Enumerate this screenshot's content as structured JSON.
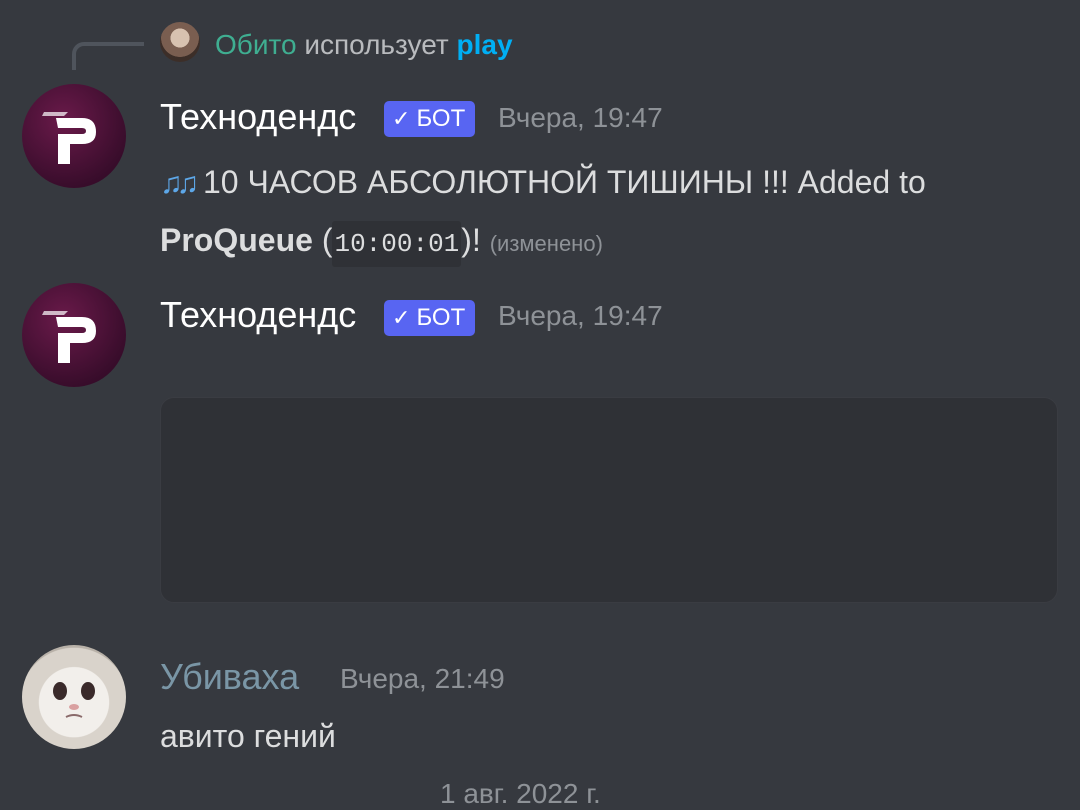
{
  "reply": {
    "user": "Обито",
    "verb": "использует",
    "command": "play"
  },
  "messages": [
    {
      "author": "Технодендс",
      "tag": "БОТ",
      "time": "Вчера, 19:47",
      "song_title": "10 ЧАСОВ АБСОЛЮТНОЙ ТИШИНЫ !!!",
      "added_to": "Added to",
      "queue_name": "ProQueue",
      "open_paren": "(",
      "duration": "10:00:01",
      "close_paren": ")!",
      "edited": "(изменено)"
    },
    {
      "author": "Технодендс",
      "tag": "БОТ",
      "time": "Вчера, 19:47"
    },
    {
      "author": "Убиваха",
      "time": "Вчера, 21:49",
      "text": "авито гений"
    }
  ],
  "date_divider": "1 авг. 2022 г.",
  "colors": {
    "background": "#36393f",
    "bot_tag": "#5865f2",
    "reply_user": "#3fae91",
    "command": "#00aff4",
    "user_name": "#7a96a6"
  },
  "icons": {
    "music": "music-notes-icon",
    "check": "check-icon"
  }
}
